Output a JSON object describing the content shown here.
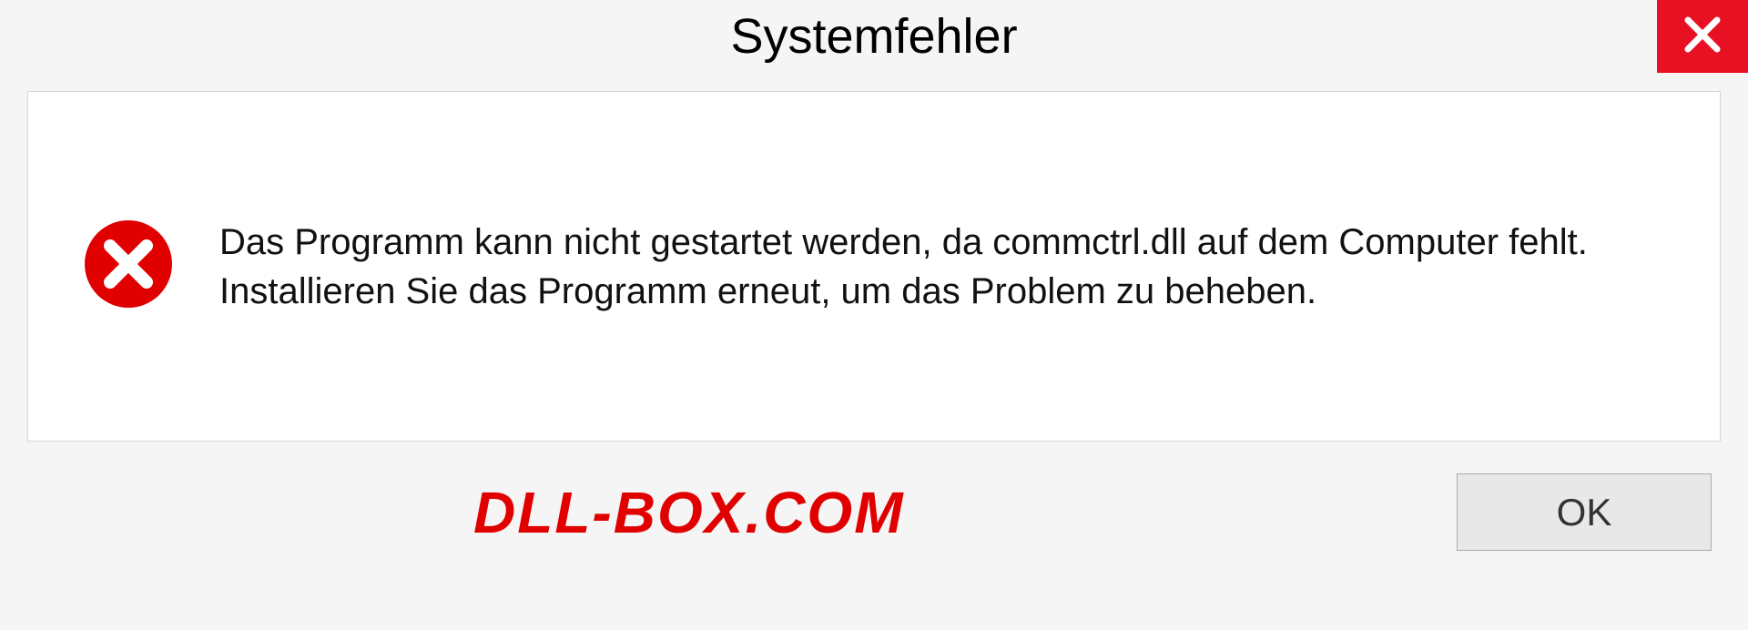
{
  "dialog": {
    "title": "Systemfehler",
    "message": "Das Programm kann nicht gestartet werden, da commctrl.dll auf dem Computer fehlt. Installieren Sie das Programm erneut, um das Problem zu beheben.",
    "ok_label": "OK"
  },
  "watermark": "DLL-BOX.COM",
  "colors": {
    "close_bg": "#e81123",
    "error_red": "#e00000"
  }
}
